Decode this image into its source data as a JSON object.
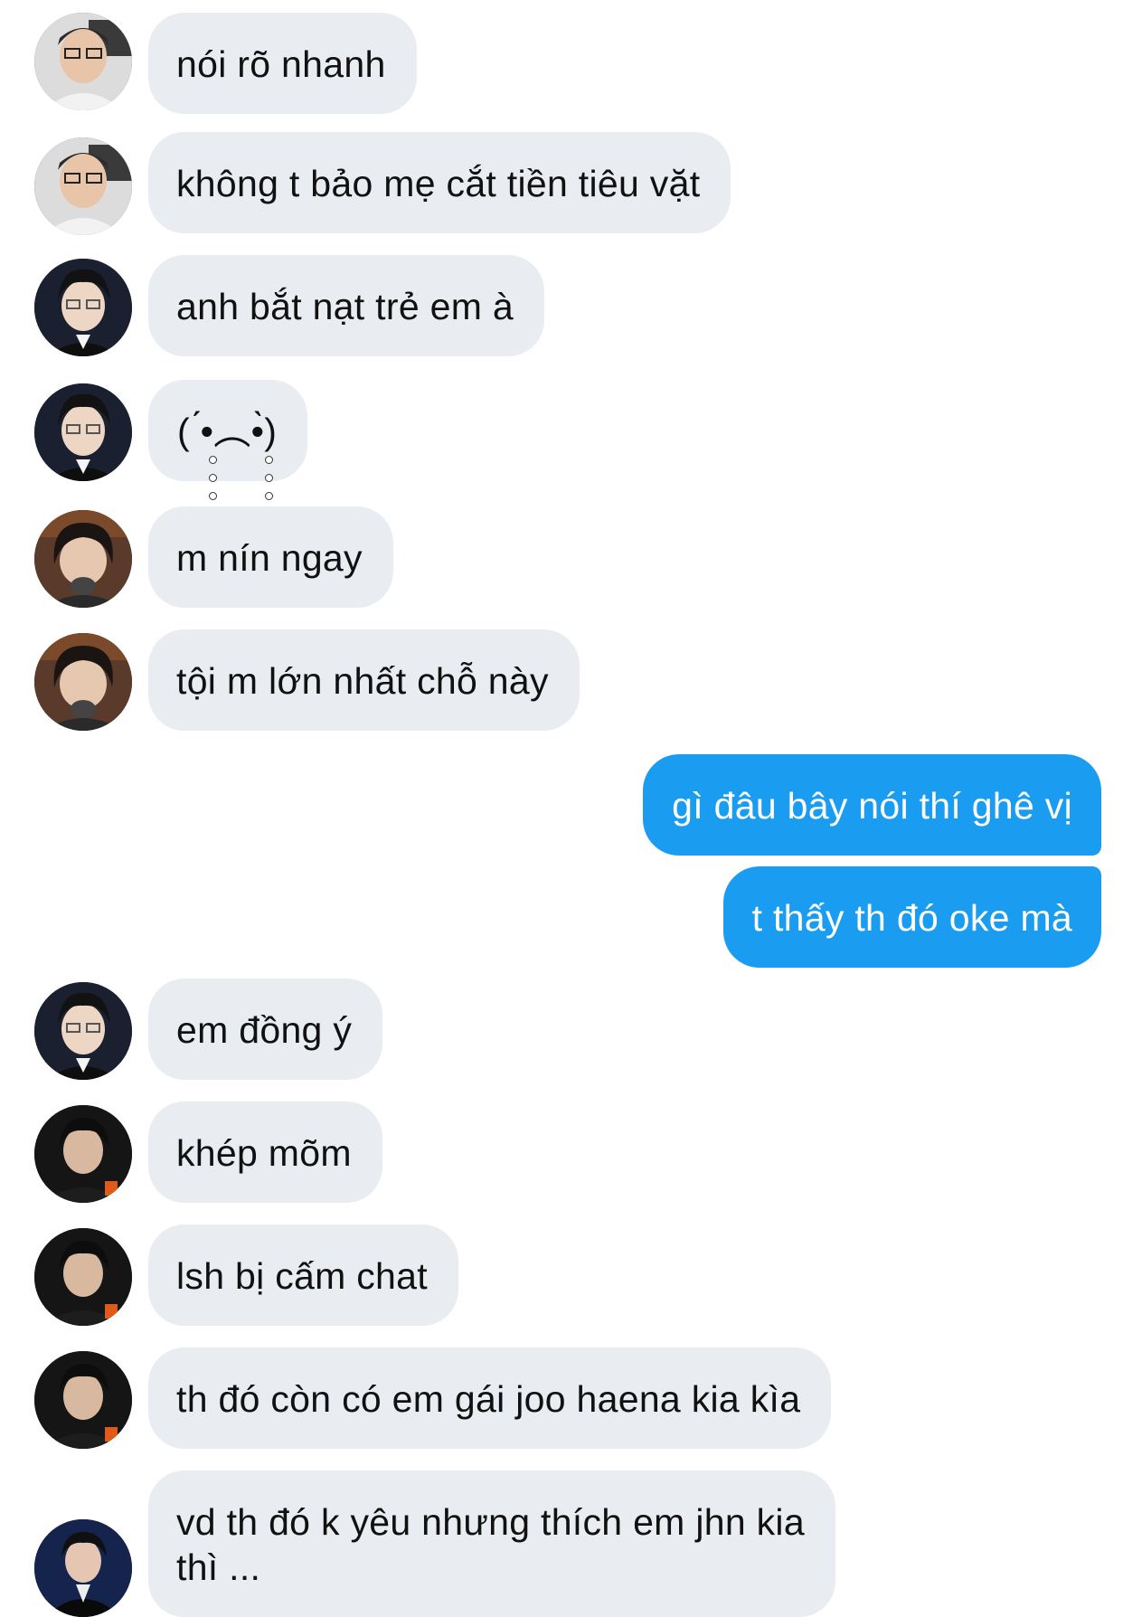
{
  "messages": [
    {
      "id": "m1",
      "sender": "other",
      "avatar": "avatar-a",
      "text": "nói rõ nhanh"
    },
    {
      "id": "m2",
      "sender": "other",
      "avatar": "avatar-a",
      "text": "không t bảo mẹ cắt tiền tiêu vặt"
    },
    {
      "id": "m3",
      "sender": "other",
      "avatar": "avatar-b",
      "text": "anh bắt nạt trẻ em à"
    },
    {
      "id": "m4",
      "sender": "other",
      "avatar": "avatar-b",
      "text": "( ́•︵•̀)"
    },
    {
      "id": "m5",
      "sender": "other",
      "avatar": "avatar-c",
      "text": "m nín ngay"
    },
    {
      "id": "m6",
      "sender": "other",
      "avatar": "avatar-c",
      "text": "tội m lớn nhất chỗ này"
    },
    {
      "id": "m7",
      "sender": "me",
      "text": "gì đâu bây nói thí ghê vị"
    },
    {
      "id": "m8",
      "sender": "me",
      "text": "t thấy th đó oke mà"
    },
    {
      "id": "m9",
      "sender": "other",
      "avatar": "avatar-b",
      "text": "em đồng ý"
    },
    {
      "id": "m10",
      "sender": "other",
      "avatar": "avatar-d",
      "text": "khép mõm"
    },
    {
      "id": "m11",
      "sender": "other",
      "avatar": "avatar-d",
      "text": "lsh bị cấm chat"
    },
    {
      "id": "m12",
      "sender": "other",
      "avatar": "avatar-d",
      "text": "th đó còn có em gái joo haena kia kìa"
    },
    {
      "id": "m13",
      "sender": "other",
      "avatar": "avatar-e",
      "text": "vd th đó k yêu nhưng thích em jhn kia\nthì ..."
    }
  ],
  "colors": {
    "incoming_bubble": "#e9ecf0",
    "outgoing_bubble": "#1a9df0",
    "incoming_text": "#111111",
    "outgoing_text": "#ffffff"
  }
}
